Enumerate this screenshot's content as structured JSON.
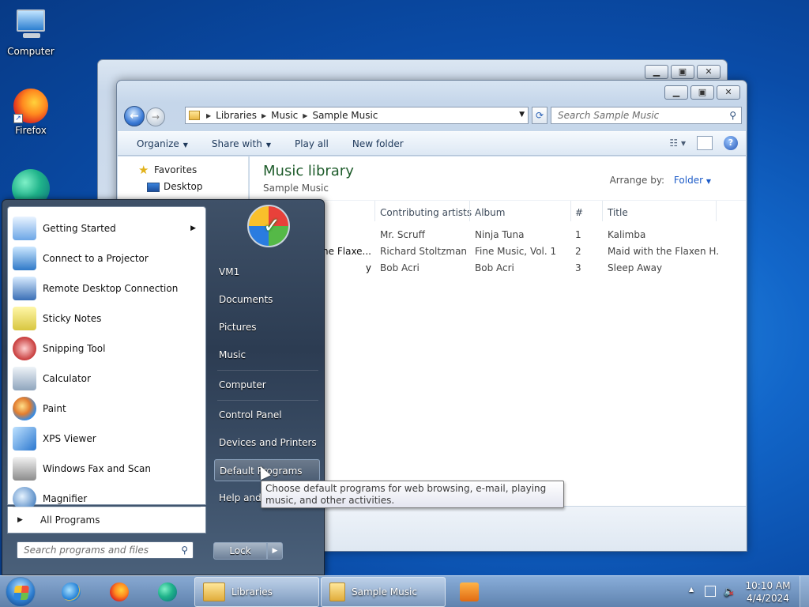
{
  "desktop": {
    "icons": [
      {
        "label": "Computer"
      },
      {
        "label": "Firefox"
      },
      {
        "label": ""
      }
    ]
  },
  "explorer": {
    "address": [
      "Libraries",
      "Music",
      "Sample Music"
    ],
    "search_placeholder": "Search Sample Music",
    "toolbar": {
      "organize": "Organize",
      "share_with": "Share with",
      "play_all": "Play all",
      "new_folder": "New folder"
    },
    "nav": {
      "favorites": "Favorites",
      "desktop": "Desktop"
    },
    "library_title": "Music library",
    "library_subtitle": "Sample Music",
    "arrange_label": "Arrange by:",
    "arrange_value": "Folder",
    "columns": {
      "artists": "Contributing artists",
      "album": "Album",
      "number": "#",
      "title": "Title"
    },
    "rows": [
      {
        "name": "",
        "artists": "Mr. Scruff",
        "album": "Ninja Tuna",
        "number": "1",
        "title": "Kalimba"
      },
      {
        "name": "the Flaxe...",
        "artists": "Richard Stoltzman...",
        "album": "Fine Music, Vol. 1",
        "number": "2",
        "title": "Maid with the Flaxen H..."
      },
      {
        "name": "y",
        "artists": "Bob Acri",
        "album": "Bob Acri",
        "number": "3",
        "title": "Sleep Away"
      }
    ]
  },
  "start_menu": {
    "programs": [
      {
        "label": "Getting Started",
        "icon": "getting-started-icon",
        "has_submenu": true
      },
      {
        "label": "Connect to a Projector",
        "icon": "projector-icon"
      },
      {
        "label": "Remote Desktop Connection",
        "icon": "remote-desktop-icon"
      },
      {
        "label": "Sticky Notes",
        "icon": "sticky-notes-icon"
      },
      {
        "label": "Snipping Tool",
        "icon": "snipping-tool-icon"
      },
      {
        "label": "Calculator",
        "icon": "calculator-icon"
      },
      {
        "label": "Paint",
        "icon": "paint-icon"
      },
      {
        "label": "XPS Viewer",
        "icon": "xps-viewer-icon"
      },
      {
        "label": "Windows Fax and Scan",
        "icon": "fax-scan-icon"
      },
      {
        "label": "Magnifier",
        "icon": "magnifier-icon"
      }
    ],
    "all_programs": "All Programs",
    "search_placeholder": "Search programs and files",
    "right_links": {
      "user": "VM1",
      "documents": "Documents",
      "pictures": "Pictures",
      "music": "Music",
      "computer": "Computer",
      "control_panel": "Control Panel",
      "devices_printers": "Devices and Printers",
      "default_programs": "Default Programs",
      "help_support": "Help and"
    },
    "lock_label": "Lock",
    "tooltip": "Choose default programs for web browsing, e-mail, playing music, and other activities."
  },
  "taskbar": {
    "tasks": [
      {
        "label": "Libraries"
      },
      {
        "label": "Sample Music"
      }
    ],
    "clock_time": "10:10 AM",
    "clock_date": "4/4/2024"
  },
  "colors": {
    "library_title": "#1e5c2b",
    "link_blue": "#1e5cc8"
  }
}
